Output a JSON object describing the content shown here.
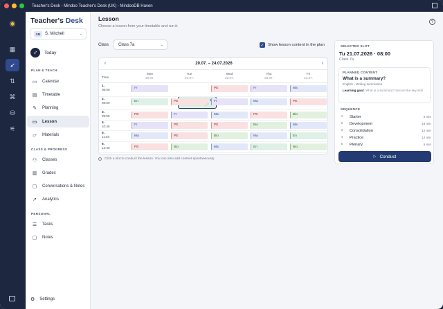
{
  "window": {
    "title": "Teacher's Desk - Mindoo Teacher's Desk (UK) - MindooDB Haven",
    "colors": {
      "close": "#ff5f57",
      "min": "#febc2e",
      "max": "#28c840"
    }
  },
  "rail": {
    "items": [
      {
        "icon": "grid-icon"
      },
      {
        "icon": "rocket-icon",
        "active": true
      },
      {
        "icon": "sync-icon"
      },
      {
        "icon": "network-icon"
      },
      {
        "icon": "database-icon"
      },
      {
        "icon": "sliders-icon"
      }
    ]
  },
  "brand": {
    "part1": "Teacher's ",
    "part2": "Desk"
  },
  "user": {
    "initials": "SM",
    "name": "S. Mitchell"
  },
  "today": "Today",
  "sections": {
    "plan": "PLAN & TEACH",
    "class": "CLASS & PROGRESS",
    "personal": "PERSONAL"
  },
  "nav": {
    "calendar": "Calendar",
    "timetable": "Timetable",
    "planning": "Planning",
    "lesson": "Lesson",
    "materials": "Materials",
    "classes": "Classes",
    "grades": "Grades",
    "conversations": "Conversations & Notes",
    "analytics": "Analytics",
    "tasks": "Tasks",
    "notes": "Notes",
    "settings": "Settings"
  },
  "page": {
    "title": "Lesson",
    "subtitle": "Choose a lesson from your timetable and run it."
  },
  "class_filter": {
    "label": "Class",
    "value": "Class 7a"
  },
  "toggle": {
    "label": "Show lesson content in the plan"
  },
  "grid": {
    "range": "20.07. – 24.07.2026",
    "time_label": "Time",
    "days": [
      {
        "d": "Mon",
        "date": "20.07."
      },
      {
        "d": "Tue",
        "date": "21.07."
      },
      {
        "d": "Wed",
        "date": "22.07."
      },
      {
        "d": "Thu",
        "date": "23.07."
      },
      {
        "d": "Fri",
        "date": "24.07."
      }
    ],
    "periods": [
      {
        "n": "1.",
        "t": "08:00"
      },
      {
        "n": "2.",
        "t": "08:50"
      },
      {
        "n": "3.",
        "t": "09:55"
      },
      {
        "n": "4.",
        "t": "10:45"
      },
      {
        "n": "5.",
        "t": "11:50"
      },
      {
        "n": "6.",
        "t": "12:40"
      }
    ],
    "rows": [
      [
        "Fr",
        "",
        "PE",
        "Fr",
        "Ma"
      ],
      [
        "En",
        "PE",
        "Fr",
        "Ma",
        "PE"
      ],
      [
        "PE",
        "Fr",
        "Ma",
        "PE",
        "Bio"
      ],
      [
        "Fr",
        "PE",
        "PE",
        "Bio",
        "Ma"
      ],
      [
        "Ma",
        "PE",
        "Bio",
        "Ma",
        "En"
      ],
      [
        "PE",
        "Bio",
        "Ma",
        "En",
        "Bio"
      ]
    ],
    "selected": {
      "subject": "En",
      "topic": "What is a summary?"
    }
  },
  "hint": "Click a slot to conduct the lesson. You can also add content spontaneously.",
  "slot": {
    "label": "SELECTED SLOT",
    "datetime": "Tu 21.07.2026 · 08:00",
    "class": "Class 7a",
    "planned_label": "PLANNED CONTENT",
    "planned_title": "What is a summary?",
    "planned_meta": "English · Writing summaries",
    "goal_label": "Learning goal:",
    "goal_text": "What is a summary? Secure the key skill",
    "sequence_label": "SEQUENCE",
    "sequence": [
      {
        "n": "1",
        "name": "Starter",
        "min": "8 min"
      },
      {
        "n": "2",
        "name": "Development",
        "min": "18 min"
      },
      {
        "n": "3",
        "name": "Consolidation",
        "min": "12 min"
      },
      {
        "n": "4",
        "name": "Practice",
        "min": "12 min"
      },
      {
        "n": "5",
        "name": "Plenary",
        "min": "5 min"
      }
    ],
    "conduct": "Conduct"
  }
}
